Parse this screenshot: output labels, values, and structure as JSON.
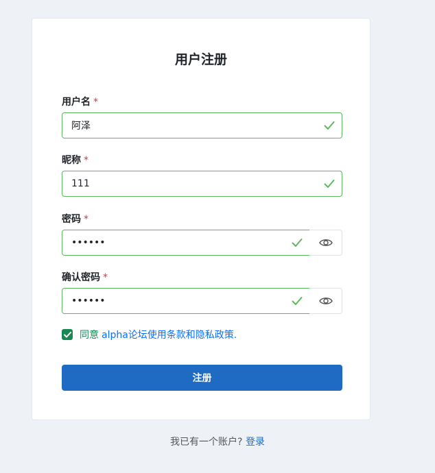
{
  "form": {
    "title": "用户注册",
    "fields": {
      "username": {
        "label": "用户名",
        "required_mark": "*",
        "value": "阿泽"
      },
      "nickname": {
        "label": "昵称",
        "required_mark": "*",
        "value": "111"
      },
      "password": {
        "label": "密码",
        "required_mark": "*",
        "value": "111111"
      },
      "confirm_password": {
        "label": "确认密码",
        "required_mark": "*",
        "value": "111111"
      }
    },
    "agree": {
      "checked": true,
      "text": "同意",
      "link": "alpha论坛使用条款和隐私政策."
    },
    "submit_label": "注册"
  },
  "footer": {
    "text": "我已有一个账户?",
    "login_link": "登录"
  },
  "colors": {
    "valid_border": "#5cb85c",
    "primary": "#1f6bc4",
    "success": "#198754",
    "required": "#dc3545",
    "background": "#eef2f7"
  },
  "icons": {
    "valid": "check-icon",
    "toggle_visibility": "eye-icon",
    "checkbox": "checkbox-checked-icon"
  }
}
